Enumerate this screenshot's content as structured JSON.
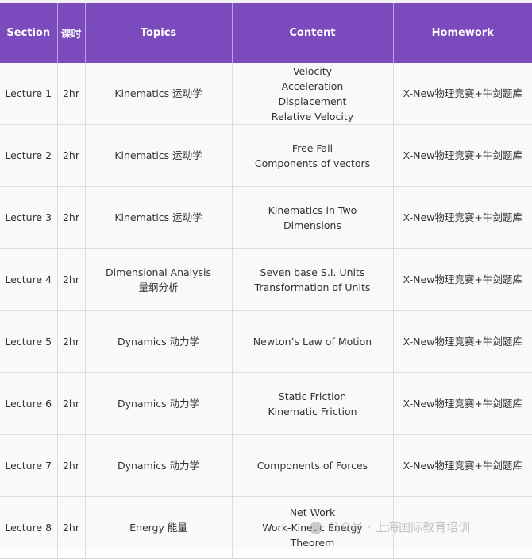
{
  "table": {
    "headers": [
      "Section",
      "课时",
      "Topics",
      "Content",
      "Homework"
    ],
    "rows": [
      {
        "section": "Lecture 1",
        "hours": "2hr",
        "topics": [
          "Kinematics 运动学"
        ],
        "content": [
          "Velocity",
          "Acceleration",
          "Displacement",
          "Relative Velocity"
        ],
        "homework": "X-New物理竞赛+牛剑题库"
      },
      {
        "section": "Lecture 2",
        "hours": "2hr",
        "topics": [
          "Kinematics 运动学"
        ],
        "content": [
          "Free Fall",
          "Components of vectors"
        ],
        "homework": "X-New物理竞赛+牛剑题库"
      },
      {
        "section": "Lecture 3",
        "hours": "2hr",
        "topics": [
          "Kinematics 运动学"
        ],
        "content": [
          "Kinematics in Two",
          "Dimensions"
        ],
        "homework": "X-New物理竞赛+牛剑题库"
      },
      {
        "section": "Lecture 4",
        "hours": "2hr",
        "topics": [
          "Dimensional Analysis",
          "量纲分析"
        ],
        "content": [
          "Seven base S.I. Units",
          "Transformation of Units"
        ],
        "homework": "X-New物理竞赛+牛剑题库"
      },
      {
        "section": "Lecture 5",
        "hours": "2hr",
        "topics": [
          "Dynamics 动力学"
        ],
        "content": [
          "Newton’s Law of Motion"
        ],
        "homework": "X-New物理竞赛+牛剑题库"
      },
      {
        "section": "Lecture 6",
        "hours": "2hr",
        "topics": [
          "Dynamics 动力学"
        ],
        "content": [
          "Static Friction",
          "Kinematic Friction"
        ],
        "homework": "X-New物理竞赛+牛剑题库"
      },
      {
        "section": "Lecture 7",
        "hours": "2hr",
        "topics": [
          "Dynamics 动力学"
        ],
        "content": [
          "Components of Forces"
        ],
        "homework": "X-New物理竞赛+牛剑题库"
      },
      {
        "section": "Lecture 8",
        "hours": "2hr",
        "topics": [
          "Energy 能量"
        ],
        "content": [
          "Net Work",
          "Work-Kinetic Energy",
          "Theorem"
        ],
        "homework": ""
      }
    ]
  },
  "watermark": {
    "icon": "wechat-icon",
    "text": "公众号 · 上海国际教育培训"
  },
  "colors": {
    "header_bg": "#7b4bbd",
    "header_text": "#ffffff"
  }
}
